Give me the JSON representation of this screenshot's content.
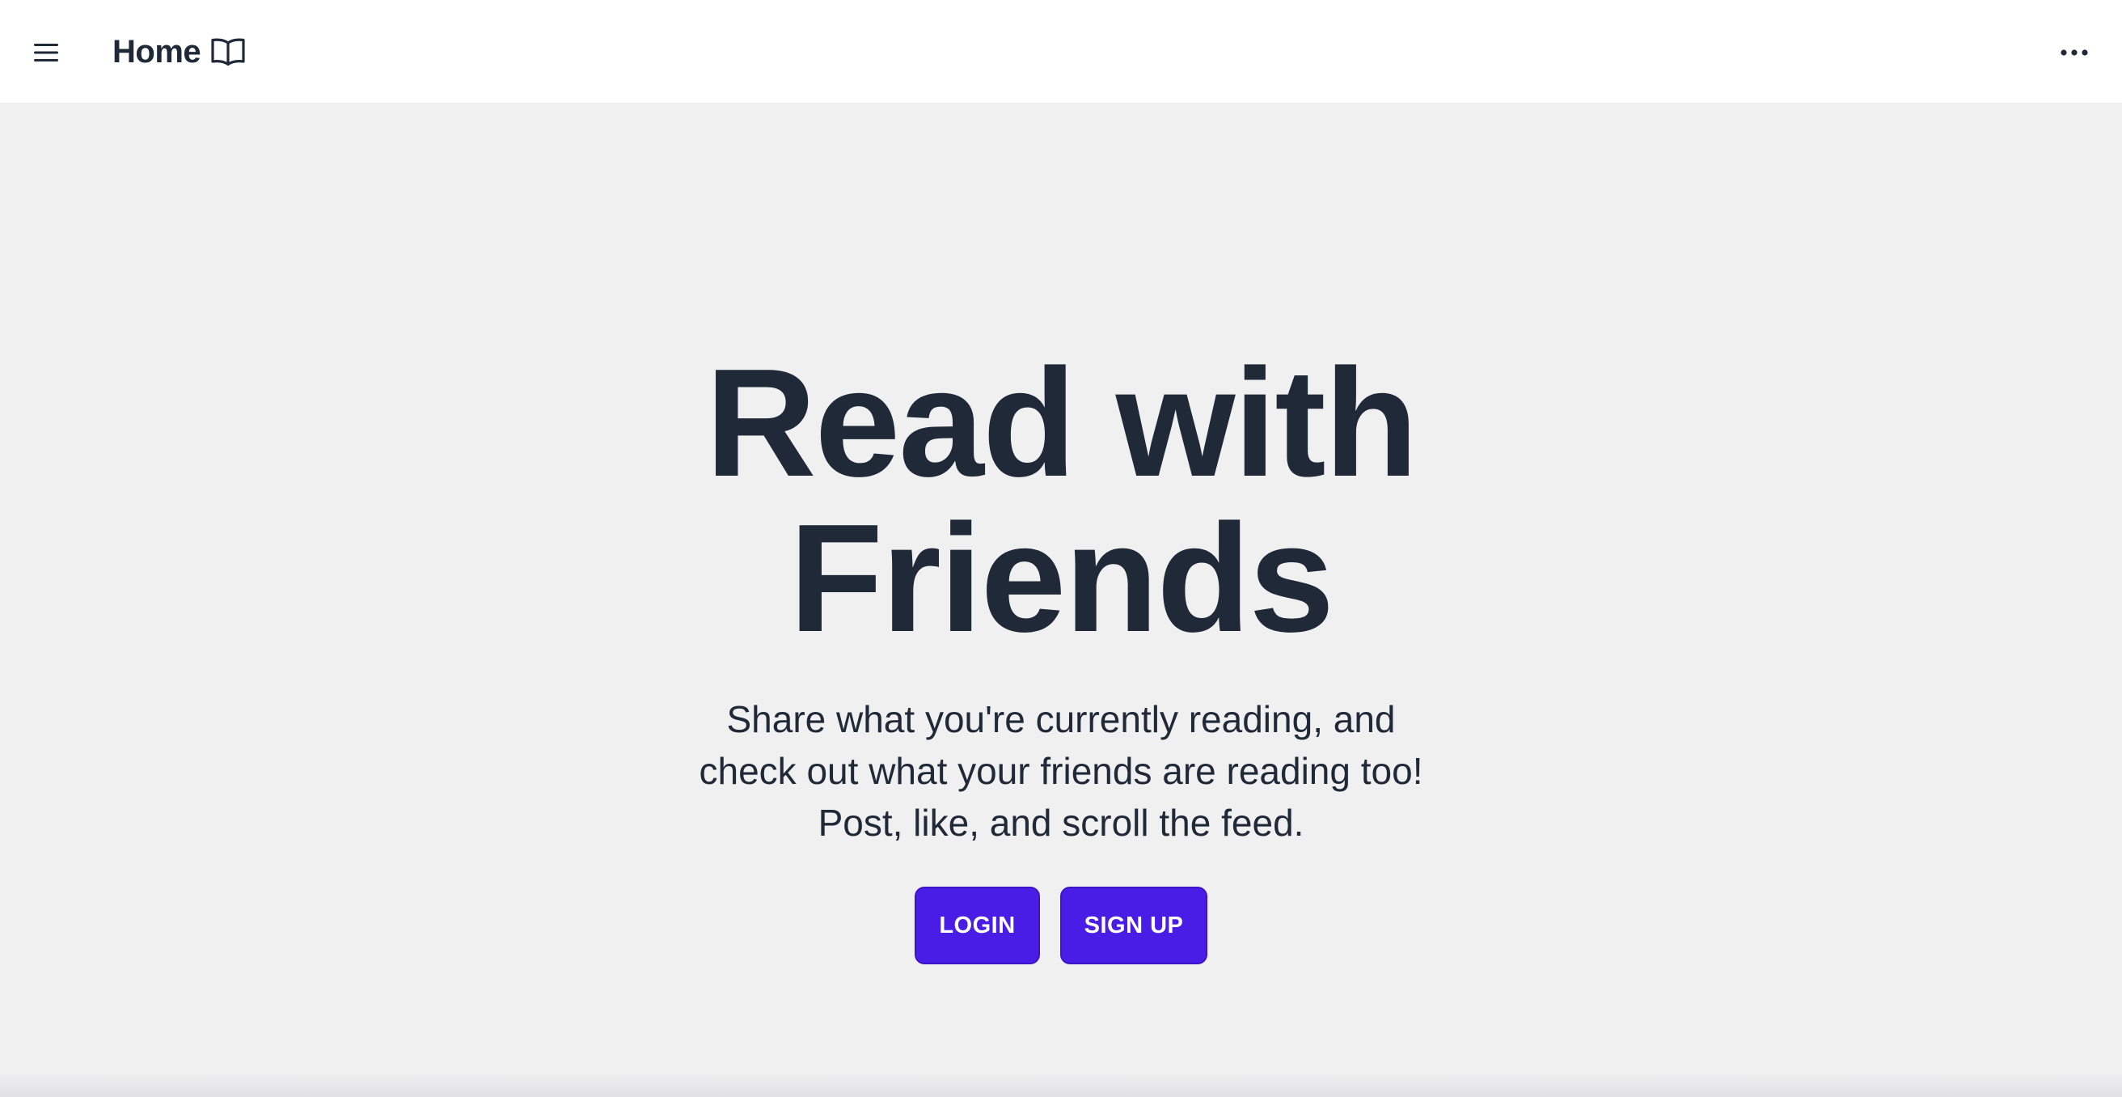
{
  "navbar": {
    "menu_icon": "hamburger-menu-icon",
    "brand_label": "Home",
    "brand_icon": "open-book-icon",
    "more_icon": "more-horizontal-icon"
  },
  "hero": {
    "title_line1": "Read with",
    "title_line2": "Friends",
    "subtitle": "Share what you're currently reading, and check out what your friends are reading too! Post, like, and scroll the feed."
  },
  "actions": {
    "login_label": "LOGIN",
    "signup_label": "SIGN UP"
  },
  "colors": {
    "background": "#f0f0f1",
    "navbar": "#ffffff",
    "text": "#1f2937",
    "primary_button": "#4a1de6"
  }
}
